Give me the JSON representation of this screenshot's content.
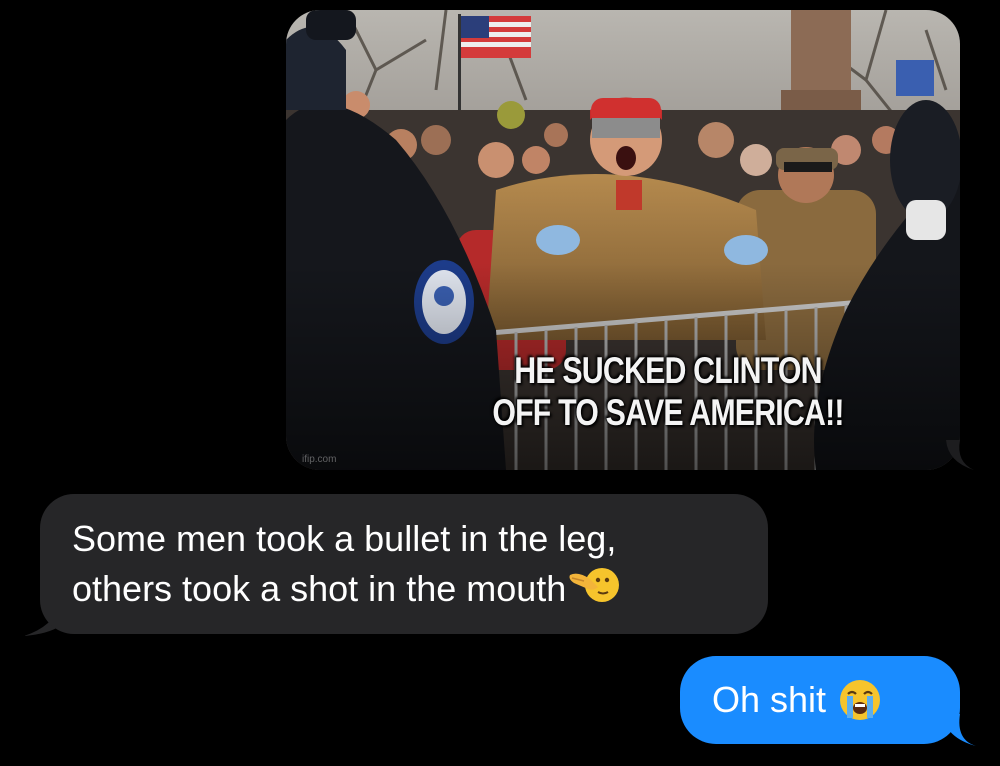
{
  "conversation": {
    "image_message": {
      "caption_line1": "HE SUCKED CLINTON",
      "caption_line2": "OFF TO SAVE AMERICA!!",
      "watermark": "ifip.com"
    },
    "incoming_message": {
      "line1": "Some men took a bullet in the leg,",
      "line2": "others took a shot in the mouth",
      "emoji": "face-with-hand-over-mouth-emoji"
    },
    "outgoing_message": {
      "text": "Oh shit",
      "emoji": "loudly-crying-face-emoji"
    }
  },
  "colors": {
    "background": "#000000",
    "incoming_bubble": "#262628",
    "outgoing_bubble": "#1a8cff",
    "text": "#ffffff"
  }
}
